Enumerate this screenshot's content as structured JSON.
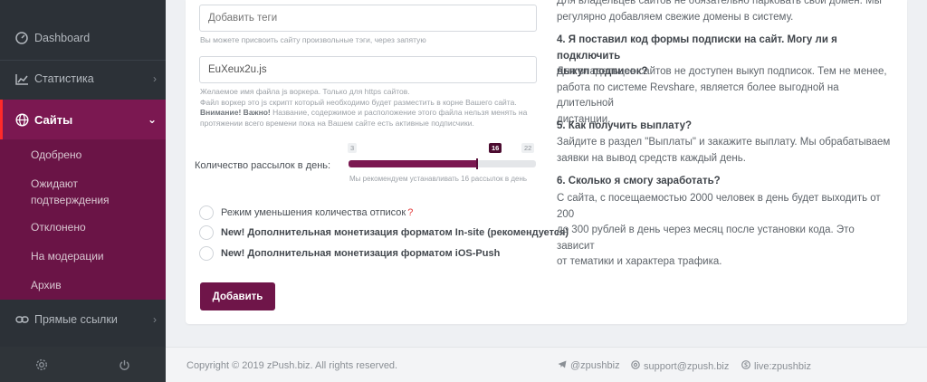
{
  "sidebar": {
    "items": [
      {
        "label": "Dashboard",
        "icon": "dashboard-icon"
      },
      {
        "label": "Статистика",
        "icon": "chart-icon"
      },
      {
        "label": "Сайты",
        "icon": "globe-icon"
      },
      {
        "label": "Прямые ссылки",
        "icon": "link-icon"
      }
    ],
    "submenu": [
      "Одобрено",
      "Ожидают подтверждения",
      "Отклонено",
      "На модерации",
      "Архив"
    ],
    "bottom_icons": [
      "gear-icon",
      "power-icon"
    ]
  },
  "form": {
    "tags_placeholder": "Добавить теги",
    "tags_hint": "Вы можете присвоить сайту произвольные тэги, через запятую",
    "worker_value": "EuXeux2u.js",
    "worker_hint1": "Желаемое имя файла js воркера. Только для https сайтов.",
    "worker_hint2": "Файл воркер это js скрипт который необходимо будет разместить в корне Вашего сайта.",
    "worker_warning": "Внимание! Важно!",
    "worker_hint3": " Название, содержимое и расположение этого файла нельзя менять на",
    "worker_hint4": "протяжении всего времени пока на Вашем сайте есть активные подписчики.",
    "slider": {
      "label": "Количество рассылок в день:",
      "min": "3",
      "value": "16",
      "max": "22",
      "value_fraction": 0.684,
      "hint": "Мы рекомендуем устанавливать 16 рассылок в день"
    },
    "options": [
      {
        "label": "Режим уменьшения количества отписок",
        "suffix": "?",
        "bold": false
      },
      {
        "label": "New! Дополнительная монетизация форматом In-site (рекомендуется)",
        "bold": true
      },
      {
        "label": "New! Дополнительная монетизация форматом iOS-Push",
        "bold": true
      }
    ],
    "submit_label": "Добавить"
  },
  "faq": {
    "intro_line1": "Для владельцев сайтов не обязательно парковать свой домен. Мы",
    "intro_line2": "регулярно добавляем свежие домены в систему.",
    "q4_line1": "4. Я поставил код формы подписки на сайт. Могу ли я подключить",
    "q4_line2": "выкуп подписок?",
    "a4_line1": "Для владельцев сайтов не доступен выкуп подписок. Тем не менее,",
    "a4_line2": "работа по системе Revshare, является более выгодной на длительной",
    "a4_line3": "дистанции.",
    "q5": "5. Как получить выплату?",
    "a5_line1": "Зайдите в раздел \"Выплаты\" и закажите выплату. Мы обрабатываем",
    "a5_line2": "заявки на вывод средств каждый день.",
    "q6": "6. Сколько я смогу заработать?",
    "a6_line1": "С сайта, с посещаемостью 2000 человек в день будет выходить от 200",
    "a6_line2": "до 300 рублей в день через месяц после установки кода. Это зависит",
    "a6_line3": "от тематики и характера трафика."
  },
  "footer": {
    "copyright": "Copyright © 2019 zPush.biz. All rights reserved.",
    "telegram": "@zpushbiz",
    "email": "support@zpush.biz",
    "skype": "live:zpushbiz"
  },
  "colors": {
    "sidebar_bg": "#2c3137",
    "accent": "#7b1851",
    "submenu_bg": "#6a1446",
    "active_marker": "#ff2a2a"
  }
}
